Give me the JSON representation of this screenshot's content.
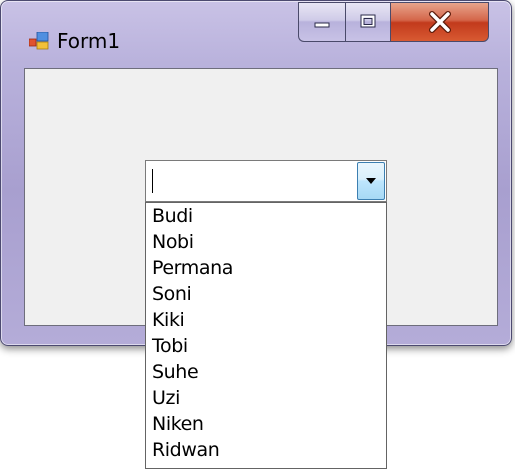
{
  "window": {
    "title": "Form1",
    "icon": "form-window-icon",
    "caption_buttons": {
      "minimize_icon": "minimize-icon",
      "maximize_icon": "maximize-icon",
      "close_icon": "close-icon"
    },
    "colors": {
      "frame": "#b9b2dc",
      "client": "#f0f0f0",
      "close_button": "#c23a1c"
    }
  },
  "combobox": {
    "value": "",
    "dropdown_icon": "chevron-down-icon",
    "items": [
      "Budi",
      "Nobi",
      "Permana",
      "Soni",
      "Kiki",
      "Tobi",
      "Suhe",
      "Uzi",
      "Niken",
      "Ridwan"
    ]
  }
}
